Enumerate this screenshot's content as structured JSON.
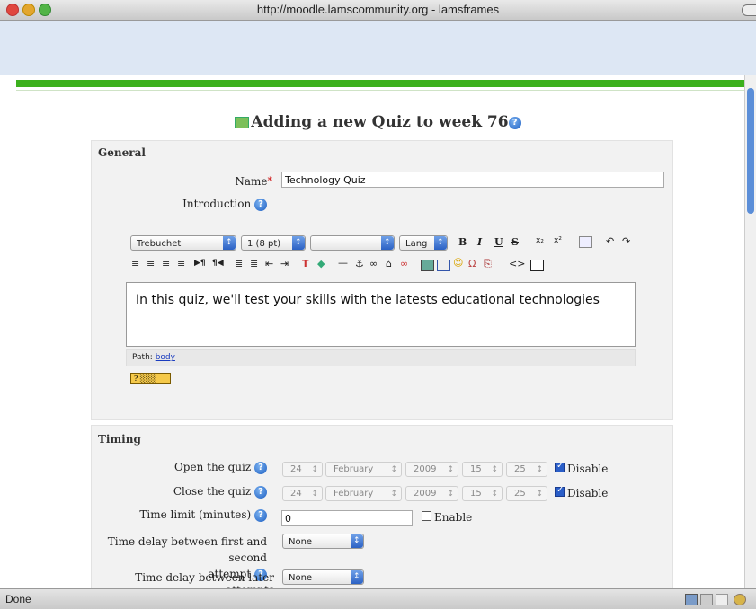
{
  "window": {
    "title": "http://moodle.lamscommunity.org - lamsframes"
  },
  "page": {
    "heading": "Adding a new Quiz to week 76"
  },
  "general": {
    "legend": "General",
    "name_label": "Name",
    "name_required": "*",
    "name_value": "Technology Quiz",
    "intro_label": "Introduction"
  },
  "editor": {
    "font": "Trebuchet",
    "size": "1 (8 pt)",
    "style": "",
    "lang": "Lang",
    "bold": "B",
    "italic": "I",
    "underline": "U",
    "strike": "S",
    "sub": "x₂",
    "sup": "x²",
    "content": "In this quiz, we'll test your skills with the latests educational technologies",
    "path_label": "Path:",
    "path_link": "body",
    "emoticon_label": "?"
  },
  "timing": {
    "legend": "Timing",
    "open_label": "Open the quiz",
    "close_label": "Close the quiz",
    "day": "24",
    "month": "February",
    "year": "2009",
    "hour": "15",
    "minute": "25",
    "disable_label": "Disable",
    "open_disabled": true,
    "close_disabled": true,
    "timelimit_label": "Time limit (minutes)",
    "timelimit_value": "0",
    "enable_label": "Enable",
    "enable_checked": false,
    "delay1_label_line1": "Time delay between first and second",
    "delay1_label_line2": "attempt",
    "delay1_value": "None",
    "delay2_label": "Time delay between later attempts",
    "delay2_value": "None"
  },
  "status": {
    "text": "Done"
  },
  "colors": {
    "accent_green": "#3cb01e",
    "toolbar_blue": "#dde7f4",
    "help_blue": "#1d5fc2"
  }
}
